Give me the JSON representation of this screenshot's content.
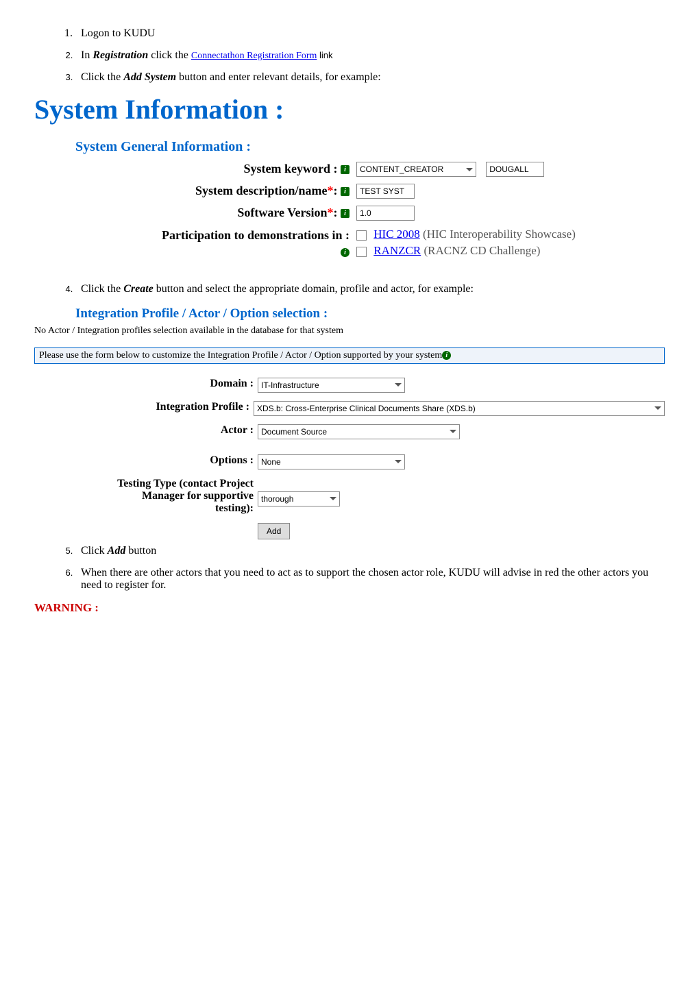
{
  "steps": {
    "s1": "Logon to KUDU",
    "s2_a": "In ",
    "s2_b": "Registration",
    "s2_c": " click the ",
    "s2_link": "Connectathon Registration Form",
    "s2_d": " link",
    "s3_a": "Click the ",
    "s3_b": "Add System",
    "s3_c": " button and enter relevant details, for example:",
    "s4_a": "Click the ",
    "s4_b": "Create",
    "s4_c": " button and select the appropriate domain, profile and actor, for example:",
    "s5_a": "Click ",
    "s5_b": "Add",
    "s5_c": " button",
    "s6": "When there are other actors that you need to act as to support the chosen actor role, KUDU will advise in red the other actors you need to register for."
  },
  "sys_info_heading": "System Information :",
  "general_heading": "System General Information :",
  "labels": {
    "keyword": "System keyword : ",
    "desc": "System description/name",
    "version": "Software Version",
    "colon": ": ",
    "part": "Participation to demonstrations in :"
  },
  "values": {
    "keyword_select": "CONTENT_CREATOR",
    "keyword_text": "DOUGALL",
    "desc": "TEST SYST",
    "version": "1.0",
    "demo1_link": "HIC 2008",
    "demo1_text": " (HIC Interoperability  Showcase)",
    "demo2_link": "RANZCR",
    "demo2_text": " (RACNZ CD Challenge)"
  },
  "ipa_heading": "Integration Profile / Actor / Option selection :",
  "no_actor_msg": "No Actor / Integration profiles selection available in the database for that system",
  "highlight_msg": "Please use the form below to customize the Integration Profile / Actor / Option supported by your system",
  "labels2": {
    "domain": "Domain :",
    "profile": "Integration Profile :",
    "actor": "Actor :",
    "options": "Options :",
    "testing1": "Testing Type (contact Project",
    "testing2": "Manager for supportive",
    "testing3": "testing):"
  },
  "values2": {
    "domain": "IT-Infrastructure",
    "profile": "XDS.b: Cross-Enterprise Clinical Documents Share (XDS.b)",
    "actor": "Document Source",
    "options": "None",
    "testing": "thorough"
  },
  "add_button": "Add",
  "warning": "WARNING :"
}
